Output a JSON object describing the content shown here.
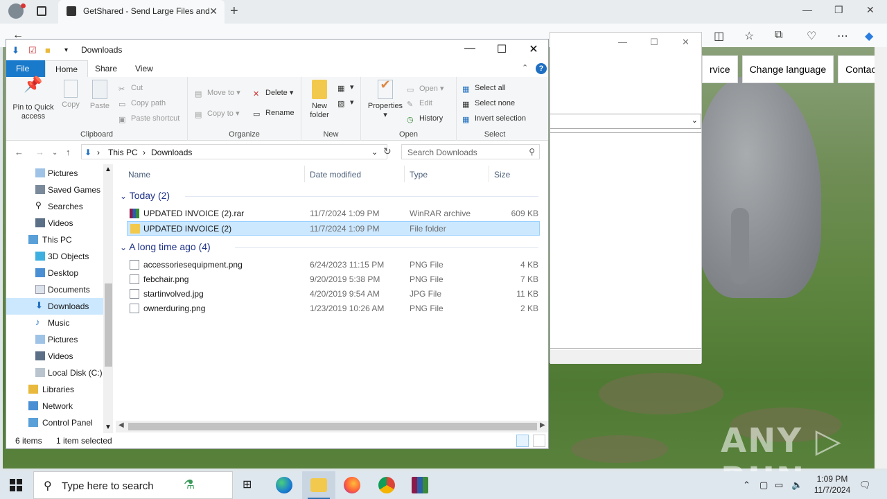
{
  "browser": {
    "tab_title": "GetShared - Send Large Files and",
    "new_tab": "+"
  },
  "site": {
    "nav": [
      "rvice",
      "Change language",
      "Contact"
    ],
    "watermark": "ANY ▷ RUN"
  },
  "explorer": {
    "title": "Downloads",
    "ribbon_tabs": [
      "File",
      "Home",
      "Share",
      "View"
    ],
    "ribbon": {
      "clipboard": {
        "label": "Clipboard",
        "pin": "Pin to Quick access",
        "copy": "Copy",
        "paste": "Paste",
        "cut": "Cut",
        "copy_path": "Copy path",
        "paste_shortcut": "Paste shortcut"
      },
      "organize": {
        "label": "Organize",
        "move_to": "Move to",
        "copy_to": "Copy to",
        "delete": "Delete",
        "rename": "Rename"
      },
      "new": {
        "label": "New",
        "new_folder": "New folder"
      },
      "open": {
        "label": "Open",
        "properties": "Properties",
        "open": "Open",
        "edit": "Edit",
        "history": "History"
      },
      "select": {
        "label": "Select",
        "select_all": "Select all",
        "select_none": "Select none",
        "invert": "Invert selection"
      }
    },
    "address": {
      "crumbs": [
        "This PC",
        "Downloads"
      ]
    },
    "search_placeholder": "Search Downloads",
    "nav_pane": [
      {
        "label": "Pictures",
        "icon": "pictures-icon"
      },
      {
        "label": "Saved Games",
        "icon": "saved-games-icon"
      },
      {
        "label": "Searches",
        "icon": "searches-icon"
      },
      {
        "label": "Videos",
        "icon": "videos-icon"
      },
      {
        "label": "This PC",
        "icon": "this-pc-icon"
      },
      {
        "label": "3D Objects",
        "icon": "3d-objects-icon"
      },
      {
        "label": "Desktop",
        "icon": "desktop-icon"
      },
      {
        "label": "Documents",
        "icon": "documents-icon"
      },
      {
        "label": "Downloads",
        "icon": "downloads-icon"
      },
      {
        "label": "Music",
        "icon": "music-icon"
      },
      {
        "label": "Pictures",
        "icon": "pictures-icon"
      },
      {
        "label": "Videos",
        "icon": "videos-icon"
      },
      {
        "label": "Local Disk (C:)",
        "icon": "disk-icon"
      },
      {
        "label": "Libraries",
        "icon": "libraries-icon"
      },
      {
        "label": "Network",
        "icon": "network-icon"
      },
      {
        "label": "Control Panel",
        "icon": "control-panel-icon"
      }
    ],
    "columns": [
      "Name",
      "Date modified",
      "Type",
      "Size"
    ],
    "groups": [
      {
        "title": "Today (2)",
        "files": [
          {
            "name": "UPDATED INVOICE (2).rar",
            "date": "11/7/2024 1:09 PM",
            "type": "WinRAR archive",
            "size": "609 KB"
          },
          {
            "name": "UPDATED INVOICE (2)",
            "date": "11/7/2024 1:09 PM",
            "type": "File folder",
            "size": ""
          }
        ]
      },
      {
        "title": "A long time ago (4)",
        "files": [
          {
            "name": "accessoriesequipment.png",
            "date": "6/24/2023 11:15 PM",
            "type": "PNG File",
            "size": "4 KB"
          },
          {
            "name": "febchair.png",
            "date": "9/20/2019 5:38 PM",
            "type": "PNG File",
            "size": "7 KB"
          },
          {
            "name": "startinvolved.jpg",
            "date": "4/20/2019 9:54 AM",
            "type": "JPG File",
            "size": "11 KB"
          },
          {
            "name": "ownerduring.png",
            "date": "1/23/2019 10:26 AM",
            "type": "PNG File",
            "size": "2 KB"
          }
        ]
      }
    ],
    "status": {
      "items": "6 items",
      "selected": "1 item selected"
    }
  },
  "taskbar": {
    "search_placeholder": "Type here to search",
    "time": "1:09 PM",
    "date": "11/7/2024"
  },
  "colors": {
    "accent": "#1979ca",
    "selection": "#cce8ff",
    "group_header": "#1e3287"
  }
}
